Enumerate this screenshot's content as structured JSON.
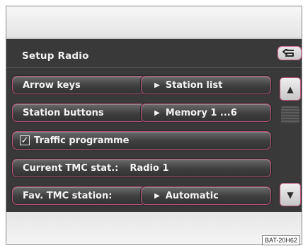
{
  "screen": {
    "title": "Setup Radio"
  },
  "rows": {
    "arrow_keys": {
      "label": "Arrow keys",
      "value": "Station list"
    },
    "station_buttons": {
      "label": "Station buttons",
      "value": "Memory 1 ...6"
    },
    "traffic_programme": {
      "label": "Traffic programme",
      "checked": true,
      "check_glyph": "✓"
    },
    "current_tmc": {
      "label": "Current TMC stat.:",
      "value": "Radio 1"
    },
    "fav_tmc": {
      "label": "Fav. TMC station:",
      "value": "Automatic"
    }
  },
  "glyphs": {
    "arrow": "▶",
    "scroll_up": "▲",
    "scroll_down": "▼"
  },
  "icons": {
    "back": "back-arrow-icon",
    "scroll_up": "triangle-up-icon",
    "scroll_down": "triangle-down-icon",
    "checkbox": "checkmark-icon"
  },
  "colors": {
    "accent_border": "#b9507c",
    "screen_bg": "#393939",
    "text": "#f3f3f3"
  },
  "watermark": "BAT-20H62"
}
